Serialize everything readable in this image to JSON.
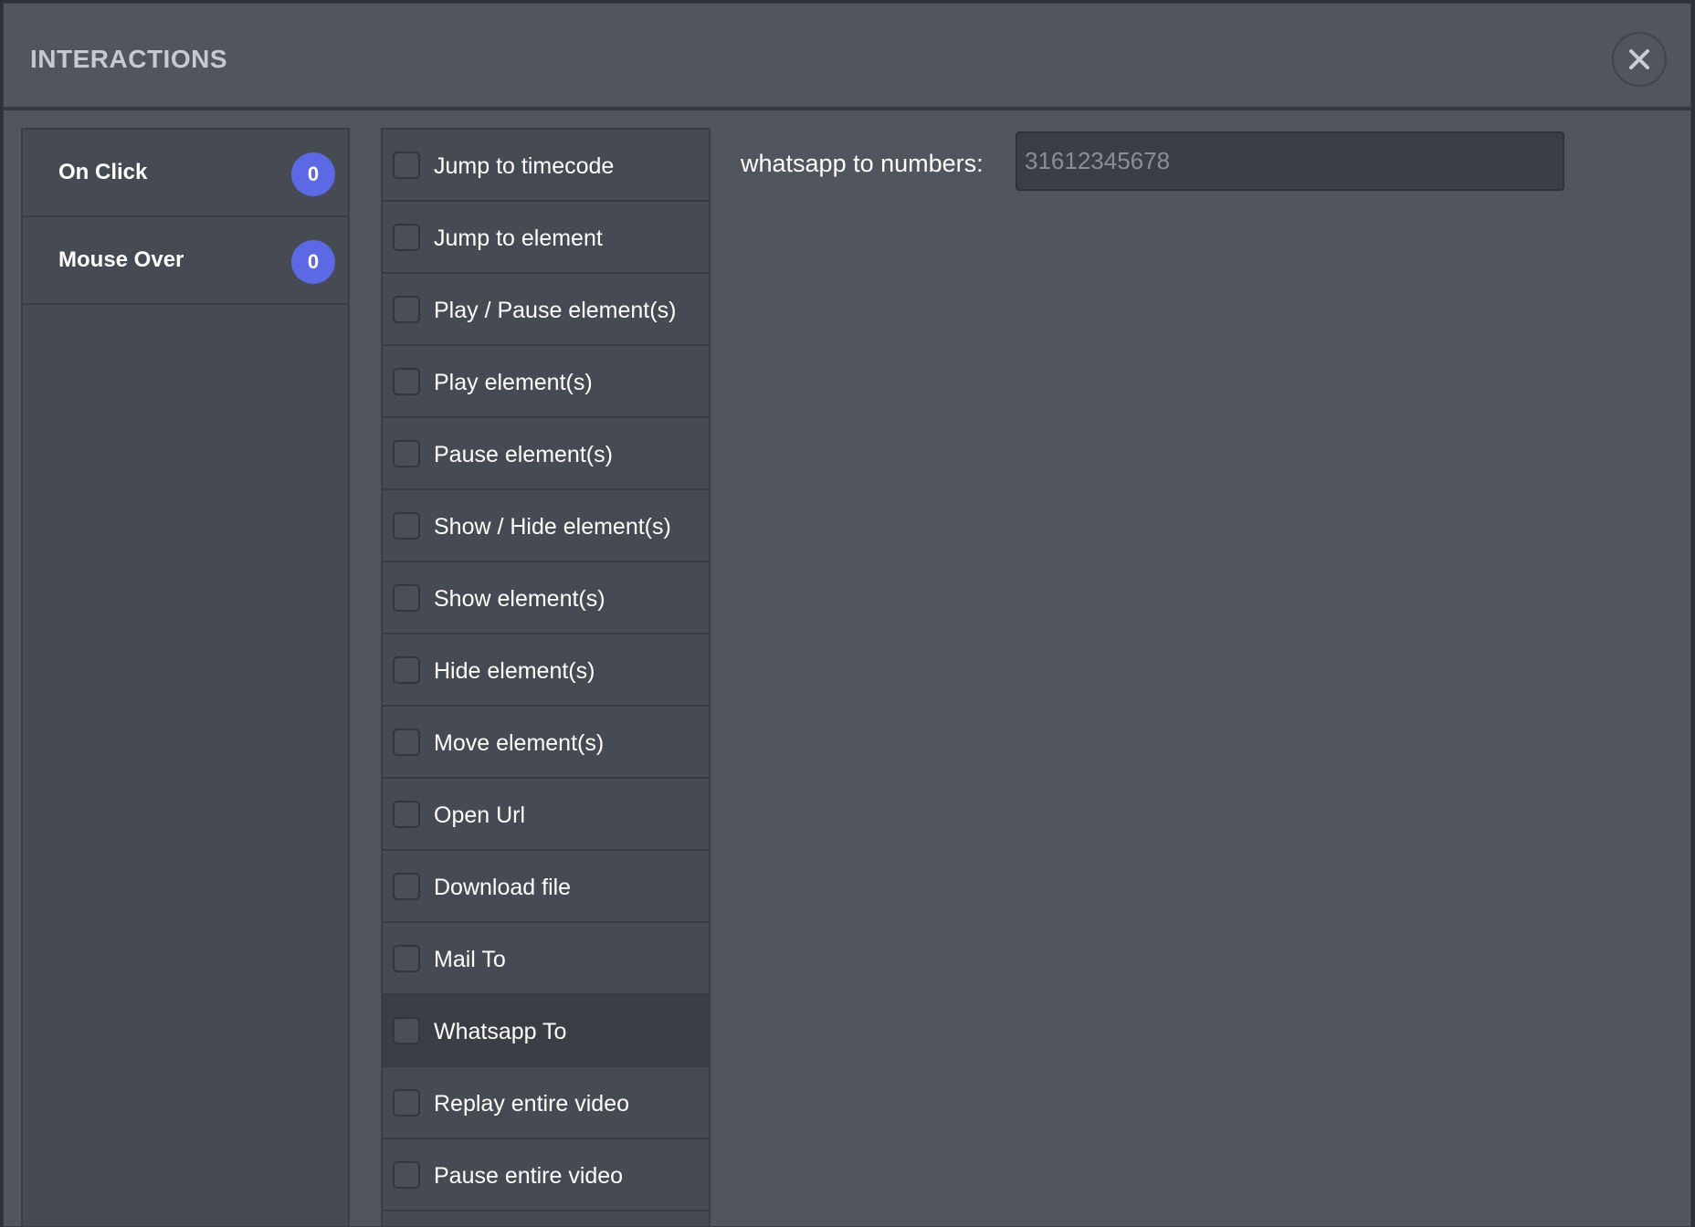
{
  "dialog": {
    "title": "INTERACTIONS",
    "close_icon": "close-icon"
  },
  "triggers": [
    {
      "label": "On Click",
      "count": "0"
    },
    {
      "label": "Mouse Over",
      "count": "0"
    }
  ],
  "actions": [
    {
      "label": "Jump to timecode",
      "checked": false
    },
    {
      "label": "Jump to element",
      "checked": false
    },
    {
      "label": "Play / Pause element(s)",
      "checked": false
    },
    {
      "label": "Play element(s)",
      "checked": false
    },
    {
      "label": "Pause element(s)",
      "checked": false
    },
    {
      "label": "Show / Hide element(s)",
      "checked": false
    },
    {
      "label": "Show element(s)",
      "checked": false
    },
    {
      "label": "Hide element(s)",
      "checked": false
    },
    {
      "label": "Move element(s)",
      "checked": false
    },
    {
      "label": "Open Url",
      "checked": false
    },
    {
      "label": "Download file",
      "checked": false
    },
    {
      "label": "Mail To",
      "checked": false
    },
    {
      "label": "Whatsapp To",
      "checked": false,
      "selected": true
    },
    {
      "label": "Replay entire video",
      "checked": false
    },
    {
      "label": "Pause entire video",
      "checked": false
    }
  ],
  "config": {
    "label": "whatsapp to numbers:",
    "value": "",
    "placeholder": "31612345678"
  },
  "colors": {
    "badge": "#5b6ae4",
    "background": "#50555e",
    "panel": "#464b53",
    "selected_row": "#3b3e45"
  }
}
